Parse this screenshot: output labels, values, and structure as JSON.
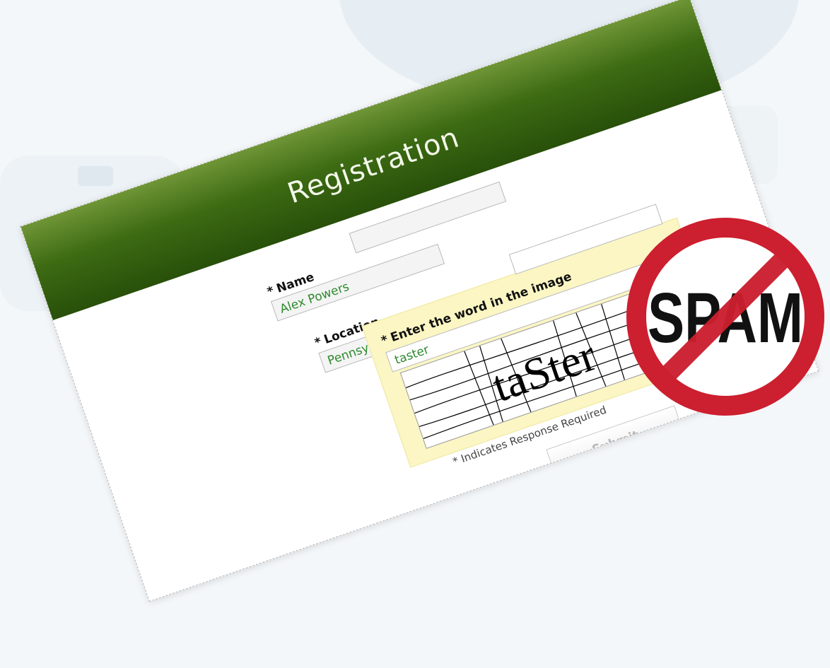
{
  "form": {
    "title": "Registration",
    "required_marker": "*",
    "name_label": "Name",
    "name_value": "Alex Powers",
    "location_label": "Location",
    "location_value": "Pennsylvania",
    "captcha_label": "Enter the word in the image",
    "captcha_value": "taster",
    "captcha_image_text": "taSter",
    "required_note": "* Indicates Response Required",
    "submit_label": "Submit"
  },
  "badge": {
    "text": "SPAM",
    "ring_color": "#cc1f2f",
    "text_color": "#111111"
  },
  "colors": {
    "header_green": "#3d6b13",
    "value_green": "#2e8a2e",
    "captcha_bg": "#fbf6c3"
  }
}
